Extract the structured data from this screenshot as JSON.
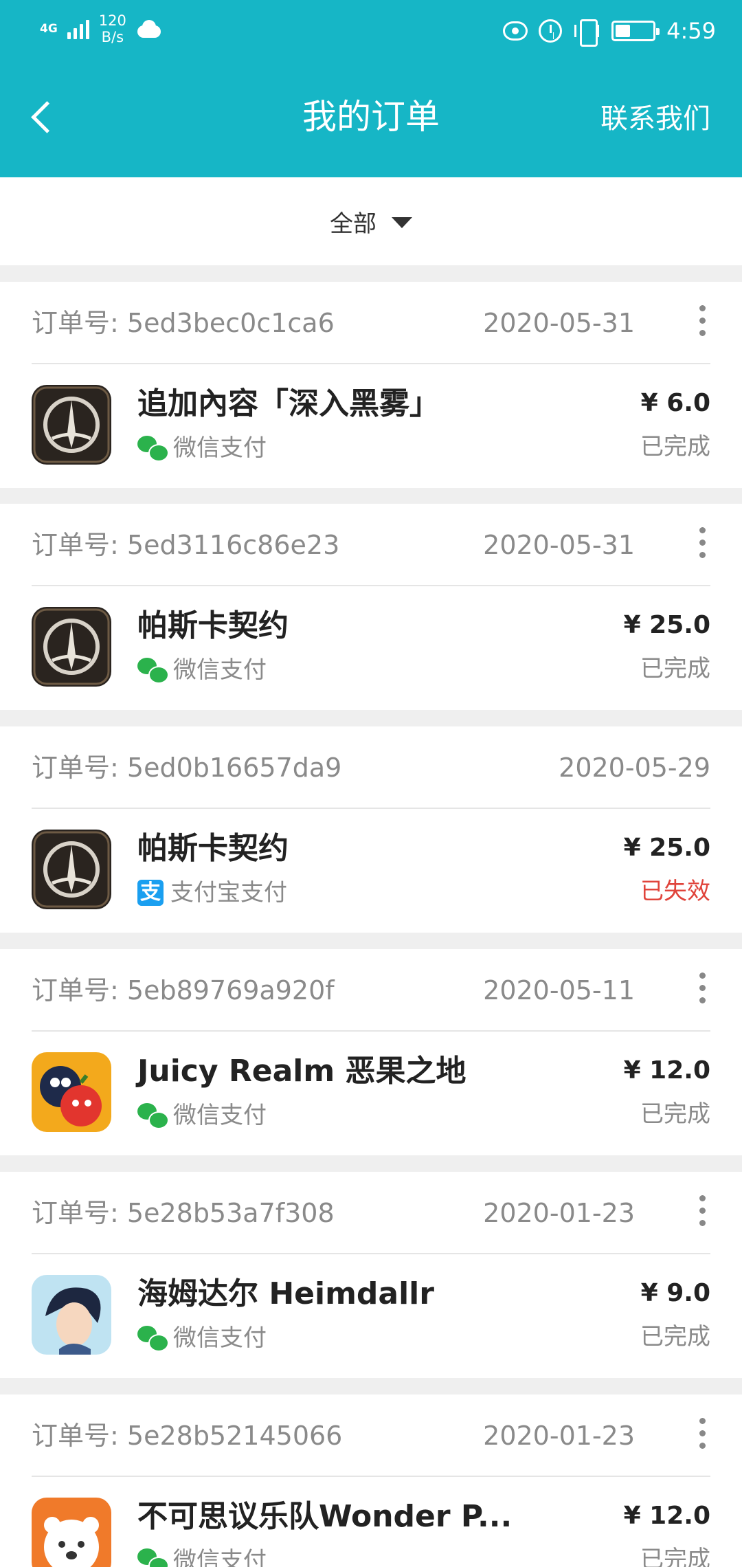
{
  "status_bar": {
    "network": "4G",
    "speed": "120",
    "speed_unit": "B/s",
    "time": "4:59",
    "battery_level": 0.4
  },
  "header": {
    "back_icon": "chevron-left-icon",
    "title": "我的订单",
    "contact_label": "联系我们",
    "color": "#16b6c6"
  },
  "filter": {
    "label": "全部"
  },
  "orders": [
    {
      "id_label": "订单号:",
      "id": "5ed3bec0c1ca6",
      "date": "2020-05-31",
      "has_more": true,
      "product": "追加內容「深入黑雾」",
      "pay_method": "微信支付",
      "pay_icon": "wechat-pay-icon",
      "price": "¥ 6.0",
      "status": "已完成",
      "icon": "pascal-contract-icon"
    },
    {
      "id_label": "订单号:",
      "id": "5ed3116c86e23",
      "date": "2020-05-31",
      "has_more": true,
      "product": "帕斯卡契约",
      "pay_method": "微信支付",
      "pay_icon": "wechat-pay-icon",
      "price": "¥ 25.0",
      "status": "已完成",
      "icon": "pascal-contract-icon"
    },
    {
      "id_label": "订单号:",
      "id": "5ed0b16657da9",
      "date": "2020-05-29",
      "has_more": false,
      "product": "帕斯卡契约",
      "pay_method": "支付宝支付",
      "pay_icon": "alipay-icon",
      "price": "¥ 25.0",
      "status": "已失效",
      "icon": "pascal-contract-icon"
    },
    {
      "id_label": "订单号:",
      "id": "5eb89769a920f",
      "date": "2020-05-11",
      "has_more": true,
      "product": "Juicy Realm 恶果之地",
      "pay_method": "微信支付",
      "pay_icon": "wechat-pay-icon",
      "price": "¥ 12.0",
      "status": "已完成",
      "icon": "juicy-realm-icon"
    },
    {
      "id_label": "订单号:",
      "id": "5e28b53a7f308",
      "date": "2020-01-23",
      "has_more": true,
      "product": "海姆达尔 Heimdallr",
      "pay_method": "微信支付",
      "pay_icon": "wechat-pay-icon",
      "price": "¥ 9.0",
      "status": "已完成",
      "icon": "heimdallr-icon"
    },
    {
      "id_label": "订单号:",
      "id": "5e28b52145066",
      "date": "2020-01-23",
      "has_more": true,
      "product": "不可思议乐队Wonder P...",
      "pay_method": "微信支付",
      "pay_icon": "wechat-pay-icon",
      "price": "¥ 12.0",
      "status": "已完成",
      "icon": "wonder-party-icon"
    }
  ]
}
